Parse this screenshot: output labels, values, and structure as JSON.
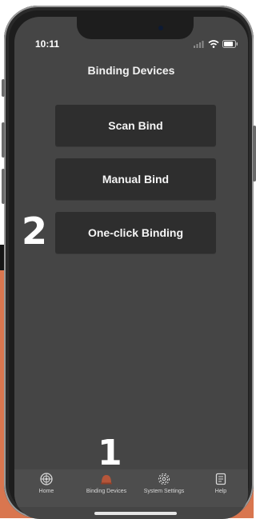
{
  "status_bar": {
    "time": "10:11"
  },
  "header": {
    "title": "Binding Devices"
  },
  "actions": [
    {
      "label": "Scan Bind"
    },
    {
      "label": "Manual Bind"
    },
    {
      "label": "One-click Binding"
    }
  ],
  "annotations": {
    "step_2": "2",
    "step_1": "1"
  },
  "tab_bar": {
    "items": [
      {
        "label": "Home",
        "icon": "home-wheel-icon",
        "active": false
      },
      {
        "label": "Binding Devices",
        "icon": "binding-devices-icon",
        "active": true
      },
      {
        "label": "System Settings",
        "icon": "gear-icon",
        "active": false
      },
      {
        "label": "Help",
        "icon": "document-icon",
        "active": false
      }
    ]
  },
  "colors": {
    "screen_bg": "#454545",
    "button_bg": "#2e2e2e",
    "tab_bar_bg": "#4d4d4d",
    "accent_active_icon": "#b5563a",
    "backdrop_orange": "#d9764f"
  }
}
